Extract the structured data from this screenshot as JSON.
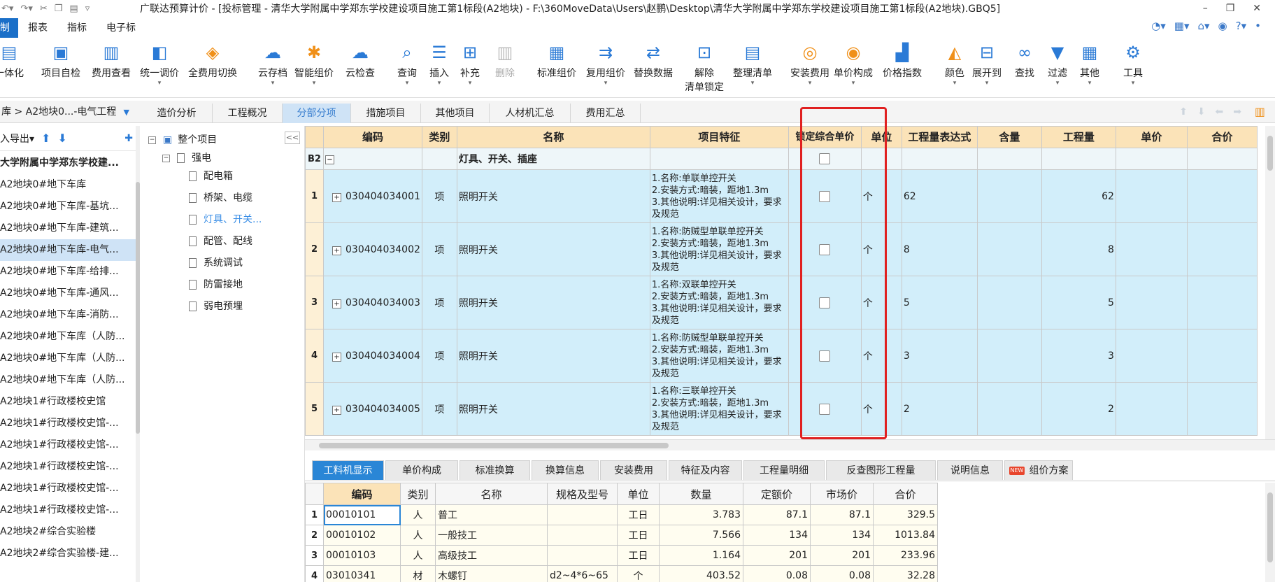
{
  "titlebar": {
    "title": "广联达预算计价 - [投标管理 - 清华大学附属中学郑东学校建设项目施工第1标段(A2地块) - F:\\360MoveData\\Users\\赵鹏\\Desktop\\清华大学附属中学郑东学校建设项目施工第1标段(A2地块).GBQ5]",
    "minimize": "–",
    "restore": "❐",
    "close": "✕"
  },
  "menu": {
    "items": [
      "制",
      "报表",
      "指标",
      "电子标"
    ]
  },
  "ribbon": {
    "buttons": [
      {
        "label": "一体化",
        "icon": "cube-icon"
      },
      {
        "label": "项目自检",
        "icon": "check-doc-icon"
      },
      {
        "label": "费用查看",
        "icon": "fee-view-icon"
      },
      {
        "label": "统一调价",
        "icon": "adjust-price-icon"
      },
      {
        "label": "全费用切换",
        "icon": "switch-fee-icon"
      },
      {
        "label": "云存档",
        "icon": "cloud-upload-icon"
      },
      {
        "label": "智能组价",
        "icon": "smart-price-icon"
      },
      {
        "label": "云检查",
        "icon": "cloud-check-icon"
      },
      {
        "label": "查询",
        "icon": "query-icon"
      },
      {
        "label": "插入",
        "icon": "insert-icon"
      },
      {
        "label": "补充",
        "icon": "supplement-icon"
      },
      {
        "label": "删除",
        "icon": "trash-icon"
      },
      {
        "label": "标准组价",
        "icon": "standard-price-icon"
      },
      {
        "label": "复用组价",
        "icon": "reuse-price-icon"
      },
      {
        "label": "替换数据",
        "icon": "replace-data-icon"
      },
      {
        "label": "解除",
        "label2": "清单锁定",
        "icon": "unlock-icon"
      },
      {
        "label": "整理清单",
        "icon": "organize-list-icon"
      },
      {
        "label": "安装费用",
        "icon": "install-fee-icon"
      },
      {
        "label": "单价构成",
        "icon": "unit-price-icon"
      },
      {
        "label": "价格指数",
        "icon": "price-index-icon"
      },
      {
        "label": "颜色",
        "icon": "paint-bucket-icon"
      },
      {
        "label": "展开到",
        "icon": "expand-icon"
      },
      {
        "label": "查找",
        "icon": "binoculars-icon"
      },
      {
        "label": "过滤",
        "icon": "filter-icon"
      },
      {
        "label": "其他",
        "icon": "grid-apps-icon"
      },
      {
        "label": "工具",
        "icon": "tools-icon"
      }
    ]
  },
  "breadcrumb": {
    "text": "库 > A2地块0...-电气工程"
  },
  "tabs": [
    "造价分析",
    "工程概况",
    "分部分项",
    "措施项目",
    "其他项目",
    "人材机汇总",
    "费用汇总"
  ],
  "left_toolbar": {
    "label": "入导出"
  },
  "project_list": [
    "大学附属中学郑东学校建...",
    "A2地块0#地下车库",
    "A2地块0#地下车库-基坑...",
    "A2地块0#地下车库-建筑...",
    "A2地块0#地下车库-电气...",
    "A2地块0#地下车库-给排...",
    "A2地块0#地下车库-通风...",
    "A2地块0#地下车库-消防...",
    "A2地块0#地下车库（人防...",
    "A2地块0#地下车库（人防...",
    "A2地块0#地下车库（人防...",
    "A2地块1#行政楼校史馆",
    "A2地块1#行政楼校史馆-...",
    "A2地块1#行政楼校史馆-...",
    "A2地块1#行政楼校史馆-...",
    "A2地块1#行政楼校史馆-...",
    "A2地块1#行政楼校史馆-...",
    "A2地块2#综合实验楼",
    "A2地块2#综合实验楼-建..."
  ],
  "tree": {
    "collapse": "<<",
    "root": "整个项目",
    "group": "强电",
    "children": [
      "配电箱",
      "桥架、电缆",
      "灯具、开关...",
      "配管、配线",
      "系统调试",
      "防雷接地",
      "弱电预埋"
    ]
  },
  "grid": {
    "headers": [
      "编码",
      "类别",
      "名称",
      "项目特征",
      "锁定综合单价",
      "单位",
      "工程量表达式",
      "含量",
      "工程量",
      "单价",
      "合价"
    ],
    "group_row": {
      "rn": "B2",
      "name": "灯具、开关、插座"
    },
    "rows": [
      {
        "rn": "1",
        "code": "030404034001",
        "type": "项",
        "name": "照明开关",
        "feat": "1.名称:单联单控开关\n2.安装方式:暗装，距地1.3m\n3.其他说明:详见相关设计，要求及规范",
        "unit": "个",
        "expr": "62",
        "qty": "62"
      },
      {
        "rn": "2",
        "code": "030404034002",
        "type": "项",
        "name": "照明开关",
        "feat": "1.名称:防贼型单联单控开关\n2.安装方式:暗装，距地1.3m\n3.其他说明:详见相关设计，要求及规范",
        "unit": "个",
        "expr": "8",
        "qty": "8"
      },
      {
        "rn": "3",
        "code": "030404034003",
        "type": "项",
        "name": "照明开关",
        "feat": "1.名称:双联单控开关\n2.安装方式:暗装，距地1.3m\n3.其他说明:详见相关设计，要求及规范",
        "unit": "个",
        "expr": "5",
        "qty": "5"
      },
      {
        "rn": "4",
        "code": "030404034004",
        "type": "项",
        "name": "照明开关",
        "feat": "1.名称:防贼型单联单控开关\n2.安装方式:暗装，距地1.3m\n3.其他说明:详见相关设计，要求及规范",
        "unit": "个",
        "expr": "3",
        "qty": "3"
      },
      {
        "rn": "5",
        "code": "030404034005",
        "type": "项",
        "name": "照明开关",
        "feat": "1.名称:三联单控开关\n2.安装方式:暗装，距地1.3m\n3.其他说明:详见相关设计，要求及规范",
        "unit": "个",
        "expr": "2",
        "qty": "2"
      }
    ]
  },
  "bottom_tabs": [
    "工料机显示",
    "单价构成",
    "标准换算",
    "换算信息",
    "安装费用",
    "特征及内容",
    "工程量明细",
    "反查图形工程量",
    "说明信息",
    "组价方案"
  ],
  "bottom_badge": "NEW",
  "bottom_grid": {
    "headers": [
      "编码",
      "类别",
      "名称",
      "规格及型号",
      "单位",
      "数量",
      "定额价",
      "市场价",
      "合价"
    ],
    "rows": [
      {
        "rn": "1",
        "code": "00010101",
        "type": "人",
        "name": "普工",
        "spec": "",
        "unit": "工日",
        "qty": "3.783",
        "quota": "87.1",
        "market": "87.1",
        "total": "329.5"
      },
      {
        "rn": "2",
        "code": "00010102",
        "type": "人",
        "name": "一般技工",
        "spec": "",
        "unit": "工日",
        "qty": "7.566",
        "quota": "134",
        "market": "134",
        "total": "1013.84"
      },
      {
        "rn": "3",
        "code": "00010103",
        "type": "人",
        "name": "高级技工",
        "spec": "",
        "unit": "工日",
        "qty": "1.164",
        "quota": "201",
        "market": "201",
        "total": "233.96"
      },
      {
        "rn": "4",
        "code": "03010341",
        "type": "材",
        "name": "木螺钉",
        "spec": "d2~4*6~65",
        "unit": "个",
        "qty": "403.52",
        "quota": "0.08",
        "market": "0.08",
        "total": "32.28"
      }
    ]
  },
  "colors": {
    "accent": "#1a6fc8",
    "highlight": "#e02020",
    "row_bg": "#d2eefa",
    "header_bg": "#fbe3b8"
  }
}
